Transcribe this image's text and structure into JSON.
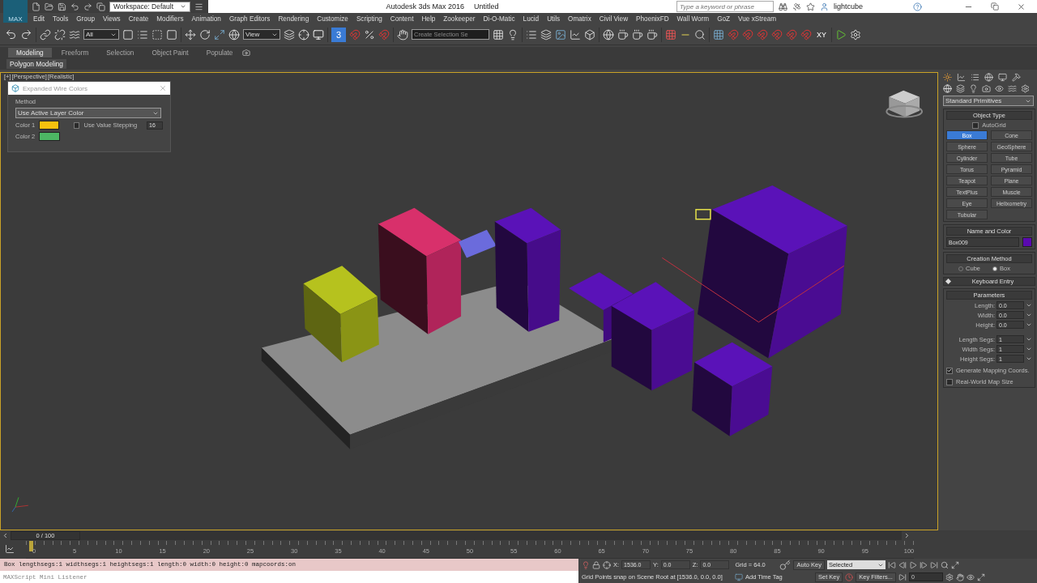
{
  "title_bar": {
    "logo": "MAX",
    "workspace": "Workspace: Default",
    "title": "Autodesk 3ds Max 2016",
    "document": "Untitled",
    "search": {
      "placeholder": "Type a keyword or phrase"
    },
    "user": "lightcube"
  },
  "menu": [
    "Edit",
    "Tools",
    "Group",
    "Views",
    "Create",
    "Modifiers",
    "Animation",
    "Graph Editors",
    "Rendering",
    "Customize",
    "Scripting",
    "Content",
    "Help",
    "Zookeeper",
    "Di-O-Matic",
    "Lucid",
    "Utils",
    "Omatrix",
    "Civil View",
    "PhoenixFD",
    "Wall Worm",
    "GoZ",
    "Vue xStream"
  ],
  "toolbar": {
    "selection_filter": "All",
    "reference_coord": "View",
    "snap_label": "3",
    "named_selection": {
      "placeholder": "Create Selection Se"
    },
    "axis_label": "XY"
  },
  "ribbon": {
    "tabs": [
      {
        "label": "Modeling",
        "selected": true
      },
      {
        "label": "Freeform",
        "selected": false
      },
      {
        "label": "Selection",
        "selected": false
      },
      {
        "label": "Object Paint",
        "selected": false
      },
      {
        "label": "Populate",
        "selected": false
      }
    ],
    "panel": "Polygon Modeling"
  },
  "viewport": {
    "labels": [
      "[+]",
      "[Perspective]",
      "[Realistic]"
    ],
    "active": true
  },
  "dialog": {
    "title": "Expanded Wire Colors",
    "method_label": "Method",
    "method": "Use Active Layer Color",
    "colors": [
      {
        "label": "Color 1",
        "color": "#f5c10e"
      },
      {
        "label": "Color 2",
        "color": "#4db764"
      }
    ],
    "stepping": {
      "label": "Use Value Stepping",
      "checked": false,
      "value": "16"
    }
  },
  "command_panel": {
    "category": "Standard Primitives",
    "object_type": {
      "title": "Object Type",
      "autogrid": {
        "label": "AutoGrid",
        "checked": false
      },
      "buttons": [
        {
          "label": "Box",
          "selected": true
        },
        {
          "label": "Cone",
          "selected": false
        },
        {
          "label": "Sphere",
          "selected": false
        },
        {
          "label": "GeoSphere",
          "selected": false
        },
        {
          "label": "Cylinder",
          "selected": false
        },
        {
          "label": "Tube",
          "selected": false
        },
        {
          "label": "Torus",
          "selected": false
        },
        {
          "label": "Pyramid",
          "selected": false
        },
        {
          "label": "Teapot",
          "selected": false
        },
        {
          "label": "Plane",
          "selected": false
        },
        {
          "label": "TextPlus",
          "selected": false
        },
        {
          "label": "Muscle",
          "selected": false
        },
        {
          "label": "Eye",
          "selected": false
        },
        {
          "label": "Helixometry",
          "selected": false
        },
        {
          "label": "Tubular",
          "selected": false
        }
      ]
    },
    "name_and_color": {
      "title": "Name and Color",
      "name": "Box009",
      "color": "#5a0ab0"
    },
    "creation_method": {
      "title": "Creation Method",
      "options": [
        {
          "label": "Cube",
          "selected": false
        },
        {
          "label": "Box",
          "selected": true
        }
      ]
    },
    "keyboard_entry": {
      "title": "Keyboard Entry",
      "expanded": false
    },
    "parameters": {
      "title": "Parameters",
      "fields": [
        {
          "label": "Length:",
          "value": "0.0"
        },
        {
          "label": "Width:",
          "value": "0.0"
        },
        {
          "label": "Height:",
          "value": "0.0"
        },
        {
          "label": "Length Segs:",
          "value": "1"
        },
        {
          "label": "Width Segs:",
          "value": "1"
        },
        {
          "label": "Height Segs:",
          "value": "1"
        }
      ],
      "checkboxes": [
        {
          "label": "Generate Mapping Coords.",
          "checked": true
        },
        {
          "label": "Real-World Map Size",
          "checked": false
        }
      ]
    }
  },
  "timeline": {
    "frame": "0 / 100",
    "level": 0,
    "ticks": [
      "0",
      "5",
      "10",
      "15",
      "20",
      "25",
      "30",
      "35",
      "40",
      "45",
      "50",
      "55",
      "60",
      "65",
      "70",
      "75",
      "80",
      "85",
      "90",
      "95",
      "100"
    ]
  },
  "status": {
    "listener_output": "Box lengthsegs:1 widthsegs:1 heightsegs:1 length:0 width:0 height:0 mapcoords:on",
    "listener_input": {
      "placeholder": "MAXScript Mini Listener"
    },
    "coords": [
      {
        "label": "X:",
        "value": "1536.0"
      },
      {
        "label": "Y:",
        "value": "0.0"
      },
      {
        "label": "Z:",
        "value": "0.0"
      }
    ],
    "grid": "Grid = 64.0",
    "prompt": "Grid Points snap on Scene Root at [1536.0, 0.0, 0.0]",
    "time_tag": "Add Time Tag",
    "auto_key": "Auto Key",
    "key_mode": "Selected",
    "set_key": "Set Key",
    "key_filters": "Key Filters...",
    "frame": "0"
  }
}
